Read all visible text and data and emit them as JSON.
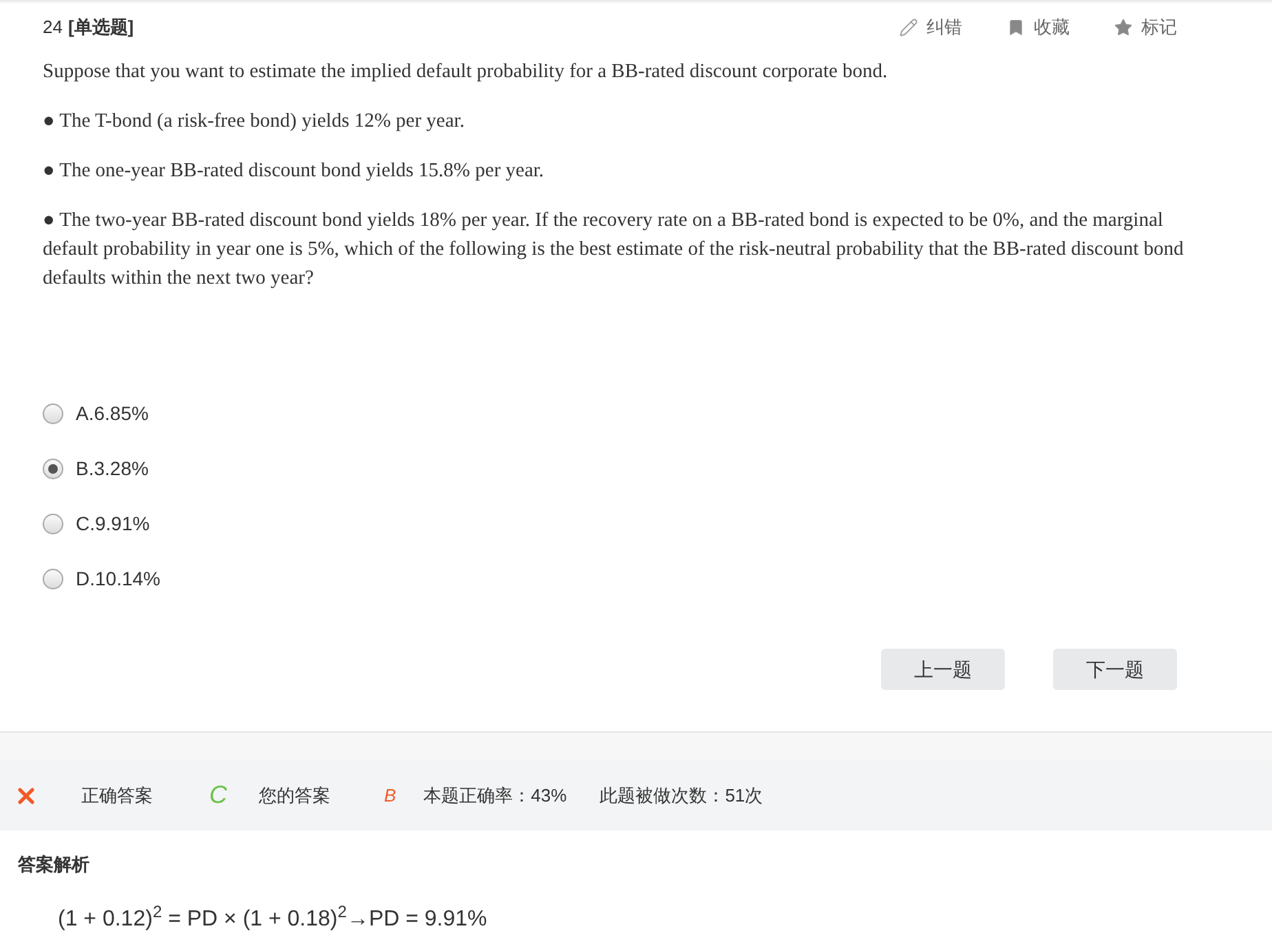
{
  "question": {
    "number": "24",
    "type": "[单选题]"
  },
  "actions": [
    {
      "kind": "edit",
      "label": "纠错"
    },
    {
      "kind": "bookmark",
      "label": "收藏"
    },
    {
      "kind": "star",
      "label": "标记"
    }
  ],
  "paragraphs": [
    "Suppose that you want to estimate the implied default probability for a BB-rated discount corporate bond.",
    "● The T-bond (a risk-free bond) yields 12% per year.",
    "● The one-year BB-rated discount bond yields 15.8% per year.",
    "● The two-year BB-rated discount bond yields 18% per year. If the recovery rate on a BB-rated bond is expected to be 0%, and the marginal default probability in year one is 5%, which of the following is the best estimate of the risk-neutral probability that the BB-rated discount bond defaults within the next two year?"
  ],
  "options": [
    {
      "label": "A.6.85%",
      "selected": false
    },
    {
      "label": "B.3.28%",
      "selected": true
    },
    {
      "label": "C.9.91%",
      "selected": false
    },
    {
      "label": "D.10.14%",
      "selected": false
    }
  ],
  "buttons": [
    "上一题",
    "下一题"
  ],
  "result": {
    "correct": false,
    "correct_label": "正确答案",
    "correct_answer": "C",
    "your_label": "您的答案",
    "your_answer": "B",
    "rate": "本题正确率：43%",
    "count": "此题被做次数：51次"
  },
  "analysis": {
    "title": "答案解析",
    "formula": "(1 + 0.12)$^{2}$ = PD × (1 + 0.18)$^{2}$→PD = 9.91%"
  }
}
